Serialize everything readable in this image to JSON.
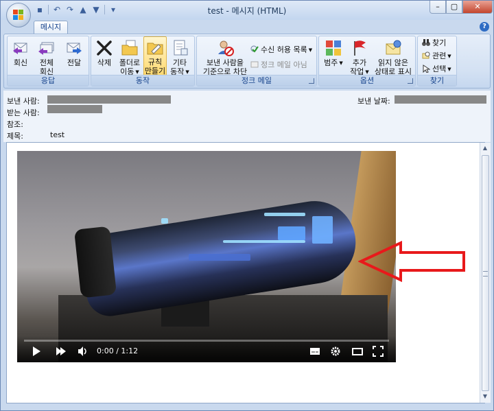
{
  "window": {
    "title": "test - 메시지 (HTML)",
    "min": "–",
    "max": "▢",
    "close": "✕"
  },
  "qat": {
    "save": "▪",
    "undo": "↶",
    "redo": "↷",
    "up": "▲",
    "down": "▼",
    "more": "▾"
  },
  "ribbon": {
    "tab": "메시지",
    "help": "?",
    "groups": {
      "respond": {
        "label": "응답",
        "reply": "회신",
        "reply_all_1": "전체",
        "reply_all_2": "회신",
        "forward": "전달"
      },
      "actions": {
        "label": "동작",
        "delete": "삭제",
        "move_1": "폴더로",
        "move_2": "이동",
        "rules_1": "규칙",
        "rules_2": "만들기",
        "other_1": "기타",
        "other_2": "동작"
      },
      "junk": {
        "label": "정크 메일",
        "block_1": "보낸 사람을",
        "block_2": "기준으로 차단",
        "safe_list": "수신 허용 목록",
        "not_junk": "정크 메일 아님"
      },
      "options": {
        "label": "옵션",
        "categorize": "범주",
        "followup_1": "추가",
        "followup_2": "작업",
        "unread_1": "읽지 않은",
        "unread_2": "상태로 표시"
      },
      "find": {
        "label": "찾기",
        "find": "찾기",
        "related": "관련",
        "select": "선택"
      }
    }
  },
  "header": {
    "from_label": "보낸 사람:",
    "sent_label": "보낸 날짜:",
    "to_label": "받는 사람:",
    "cc_label": "참조:",
    "subject_label": "제목:",
    "subject": "test"
  },
  "video": {
    "time": "0:00 / 1:12",
    "progress": 0
  },
  "colors": {
    "ribbon_blue": "#c9d9ee",
    "accent_red": "#e8191b",
    "highlight": "#ffd86b"
  }
}
